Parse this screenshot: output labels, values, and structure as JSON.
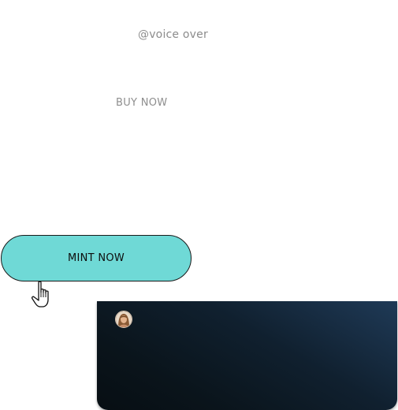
{
  "handle": "@voice over",
  "buy_now_label": "BUY NOW",
  "mint_button": {
    "label": "MINT NOW",
    "color": "#6fd9d6"
  },
  "cursor_icon": "pointer-hand-icon",
  "card": {
    "avatar_icon": "profile-avatar",
    "gradient_start": "#1f3a57",
    "gradient_end": "#070e13"
  }
}
